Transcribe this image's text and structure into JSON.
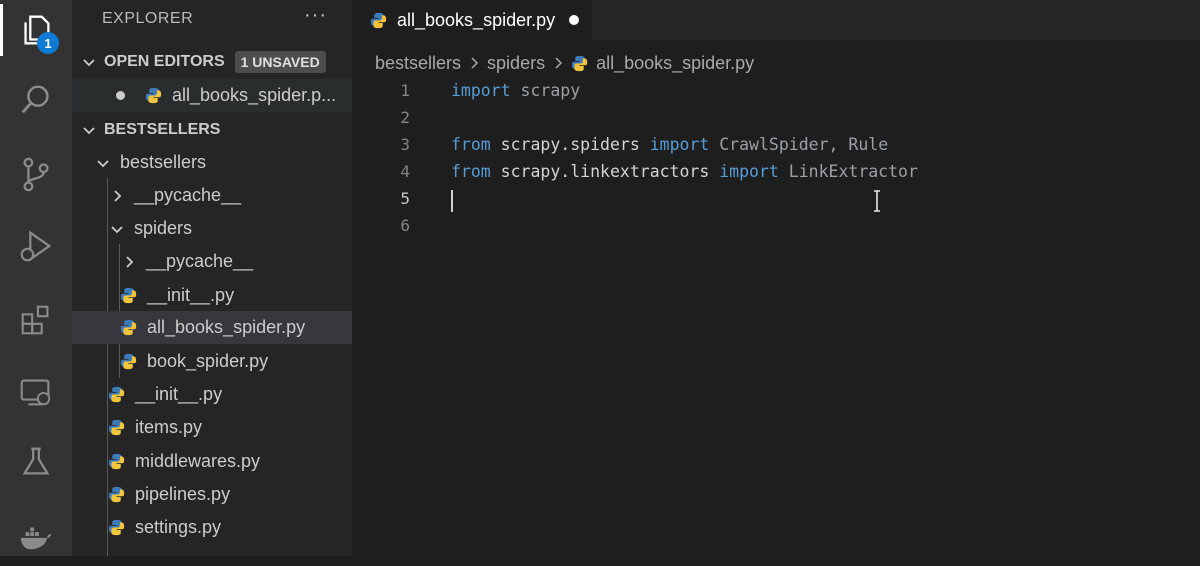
{
  "activity_bar": {
    "items": [
      {
        "name": "explorer",
        "icon": "files-icon",
        "active": true,
        "badge": "1"
      },
      {
        "name": "search",
        "icon": "search-icon"
      },
      {
        "name": "source-control",
        "icon": "source-control-icon"
      },
      {
        "name": "run-and-debug",
        "icon": "run-debug-icon"
      },
      {
        "name": "extensions",
        "icon": "extensions-icon"
      },
      {
        "name": "remote-explorer",
        "icon": "remote-explorer-icon"
      },
      {
        "name": "testing",
        "icon": "flask-icon"
      },
      {
        "name": "docker",
        "icon": "docker-icon"
      }
    ]
  },
  "sidebar": {
    "title": "EXPLORER",
    "more": "···",
    "open_editors": {
      "label": "OPEN EDITORS",
      "badge": "1 UNSAVED",
      "files": [
        {
          "name": "all_books_spider.p...",
          "unsaved": true
        }
      ]
    },
    "project": {
      "label": "BESTSELLERS",
      "tree": [
        {
          "label": "bestsellers",
          "type": "folder",
          "expanded": true
        },
        {
          "label": "__pycache__",
          "type": "folder",
          "expanded": false
        },
        {
          "label": "spiders",
          "type": "folder",
          "expanded": true
        },
        {
          "label": "__pycache__",
          "type": "folder",
          "expanded": false
        },
        {
          "label": "__init__.py",
          "type": "python"
        },
        {
          "label": "all_books_spider.py",
          "type": "python",
          "selected": true
        },
        {
          "label": "book_spider.py",
          "type": "python"
        },
        {
          "label": "__init__.py",
          "type": "python"
        },
        {
          "label": "items.py",
          "type": "python"
        },
        {
          "label": "middlewares.py",
          "type": "python"
        },
        {
          "label": "pipelines.py",
          "type": "python"
        },
        {
          "label": "settings.py",
          "type": "python"
        }
      ]
    }
  },
  "editor": {
    "tab": {
      "label": "all_books_spider.py",
      "unsaved": true
    },
    "breadcrumb": [
      "bestsellers",
      "spiders",
      "all_books_spider.py"
    ],
    "lines": [
      {
        "no": "1",
        "tokens": [
          {
            "t": "import",
            "k": "kw"
          },
          {
            "t": " scrapy",
            "k": "cls"
          }
        ]
      },
      {
        "no": "2",
        "tokens": []
      },
      {
        "no": "3",
        "tokens": [
          {
            "t": "from",
            "k": "kw"
          },
          {
            "t": " scrapy.spiders ",
            "k": "mod"
          },
          {
            "t": "import",
            "k": "kw"
          },
          {
            "t": " CrawlSpider, Rule",
            "k": "cls"
          }
        ]
      },
      {
        "no": "4",
        "tokens": [
          {
            "t": "from",
            "k": "kw"
          },
          {
            "t": " scrapy.linkextractors ",
            "k": "mod"
          },
          {
            "t": "import",
            "k": "kw"
          },
          {
            "t": " LinkExtractor",
            "k": "cls"
          }
        ]
      },
      {
        "no": "5",
        "tokens": [],
        "current": true
      },
      {
        "no": "6",
        "tokens": []
      }
    ]
  },
  "colors": {
    "accent": "#0e7ad3",
    "keyword": "#569cd6",
    "python_blue": "#3d7ab8",
    "python_yellow": "#f2c53d"
  }
}
